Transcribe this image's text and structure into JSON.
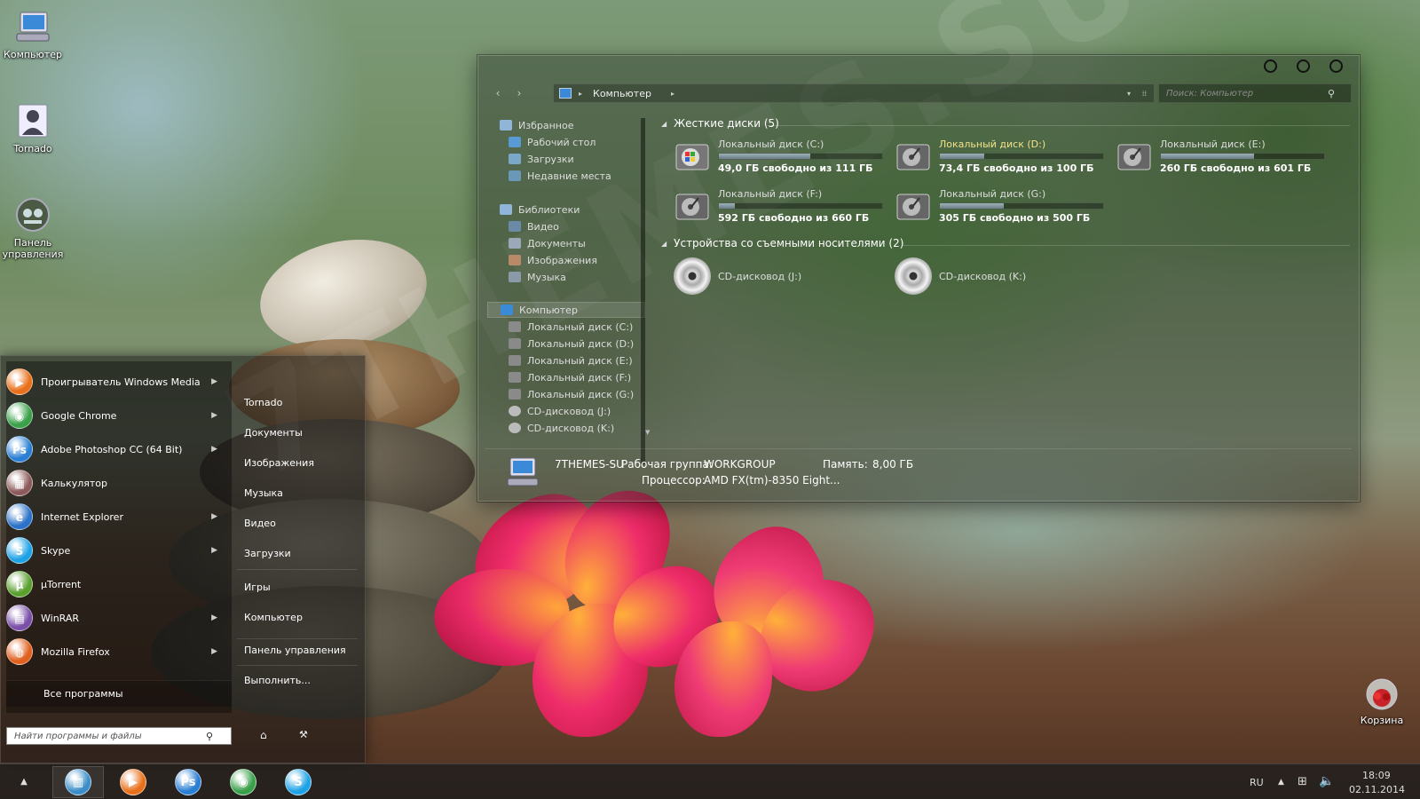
{
  "desktop": {
    "icons": [
      {
        "label": "Компьютер",
        "icon": "computer-icon"
      },
      {
        "label": "Tornado",
        "icon": "user-folder-icon"
      },
      {
        "label": "Панель управления",
        "icon": "control-panel-icon"
      },
      {
        "label": "Корзина",
        "icon": "recycle-bin-icon"
      }
    ],
    "watermark": "7THEMES.SU"
  },
  "explorer": {
    "address": {
      "crumb": "Компьютер"
    },
    "search_placeholder": "Поиск: Компьютер",
    "nav": {
      "favorites": {
        "title": "Избранное",
        "items": [
          "Рабочий стол",
          "Загрузки",
          "Недавние места"
        ]
      },
      "libraries": {
        "title": "Библиотеки",
        "items": [
          "Видео",
          "Документы",
          "Изображения",
          "Музыка"
        ]
      },
      "computer": {
        "title": "Компьютер",
        "items": [
          "Локальный диск (C:)",
          "Локальный диск (D:)",
          "Локальный диск (E:)",
          "Локальный диск (F:)",
          "Локальный диск (G:)",
          "CD-дисковод (J:)",
          "CD-дисковод (K:)"
        ]
      }
    },
    "hard_disks": {
      "title": "Жесткие диски (5)",
      "drives": [
        {
          "name": "Локальный диск (C:)",
          "free": "49,0 ГБ свободно из 111 ГБ",
          "used_fraction": 0.56
        },
        {
          "name": "Локальный диск (D:)",
          "free": "73,4 ГБ свободно из 100 ГБ",
          "used_fraction": 0.27
        },
        {
          "name": "Локальный диск (E:)",
          "free": "260 ГБ свободно из 601 ГБ",
          "used_fraction": 0.57
        },
        {
          "name": "Локальный диск (F:)",
          "free": "592 ГБ свободно из 660 ГБ",
          "used_fraction": 0.1
        },
        {
          "name": "Локальный диск (G:)",
          "free": "305 ГБ свободно из 500 ГБ",
          "used_fraction": 0.39
        }
      ]
    },
    "removable": {
      "title": "Устройства со съемными носителями (2)",
      "drives": [
        "CD-дисковод (J:)",
        "CD-дисковод (K:)"
      ]
    },
    "details": {
      "pc_name": "7THEMES-SU",
      "workgroup_label": "Рабочая группа:",
      "workgroup": "WORKGROUP",
      "memory_label": "Память:",
      "memory": "8,00 ГБ",
      "cpu_label": "Процессор:",
      "cpu": "AMD FX(tm)-8350 Eight..."
    }
  },
  "start_menu": {
    "programs": [
      {
        "label": "Проигрыватель Windows Media",
        "icon": "media-player-icon",
        "color": "#e8701a",
        "glyph": "▶",
        "arrow": true
      },
      {
        "label": "Google Chrome",
        "icon": "chrome-icon",
        "color": "#3aa04a",
        "glyph": "◉",
        "arrow": true
      },
      {
        "label": "Adobe Photoshop CC (64 Bit)",
        "icon": "photoshop-icon",
        "color": "#2a7fd4",
        "glyph": "Ps",
        "arrow": true
      },
      {
        "label": "Калькулятор",
        "icon": "calculator-icon",
        "color": "#8c5a5a",
        "glyph": "▦",
        "arrow": false
      },
      {
        "label": "Internet Explorer",
        "icon": "ie-icon",
        "color": "#2b72c8",
        "glyph": "e",
        "arrow": true
      },
      {
        "label": "Skype",
        "icon": "skype-icon",
        "color": "#1ea2e6",
        "glyph": "S",
        "arrow": true
      },
      {
        "label": "µTorrent",
        "icon": "utorrent-icon",
        "color": "#5aa02e",
        "glyph": "µ",
        "arrow": false
      },
      {
        "label": "WinRAR",
        "icon": "winrar-icon",
        "color": "#7a4fa8",
        "glyph": "▤",
        "arrow": true
      },
      {
        "label": "Mozilla Firefox",
        "icon": "firefox-icon",
        "color": "#e0601e",
        "glyph": "◍",
        "arrow": true
      }
    ],
    "all_programs": "Все программы",
    "search_placeholder": "Найти программы и файлы",
    "right_items": [
      "Tornado",
      "Документы",
      "Изображения",
      "Музыка",
      "Видео",
      "Загрузки",
      "Игры",
      "Компьютер",
      "Панель управления",
      "Выполнить..."
    ]
  },
  "taskbar": {
    "apps": [
      {
        "icon": "explorer-icon",
        "color": "#3c8ec8",
        "glyph": "▥"
      },
      {
        "icon": "media-player-icon",
        "color": "#e8701a",
        "glyph": "▶"
      },
      {
        "icon": "photoshop-icon",
        "color": "#2a7fd4",
        "glyph": "Ps"
      },
      {
        "icon": "chrome-icon",
        "color": "#3aa04a",
        "glyph": "◉"
      },
      {
        "icon": "skype-icon",
        "color": "#1ea2e6",
        "glyph": "S"
      }
    ],
    "lang": "RU",
    "time": "18:09",
    "date": "02.11.2014"
  }
}
